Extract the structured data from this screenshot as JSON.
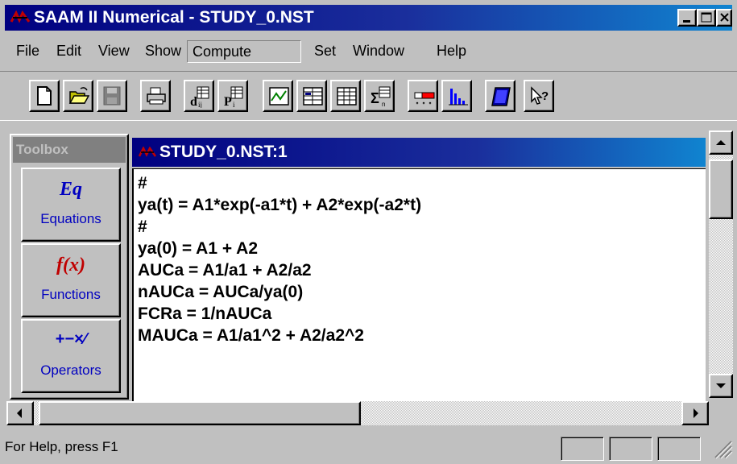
{
  "window": {
    "title": "SAAM II Numerical - STUDY_0.NST",
    "icon": "saam-app-icon"
  },
  "caption_buttons": [
    {
      "name": "minimize",
      "icon": "minimize-icon"
    },
    {
      "name": "maximize",
      "icon": "maximize-icon"
    },
    {
      "name": "close",
      "icon": "close-icon"
    }
  ],
  "menu": {
    "items": [
      {
        "label": "File"
      },
      {
        "label": "Edit"
      },
      {
        "label": "View"
      },
      {
        "label": "Show"
      },
      {
        "label": "Compute",
        "active": true
      },
      {
        "label": "Set"
      },
      {
        "label": "Window"
      },
      {
        "label": "Help"
      }
    ]
  },
  "toolbar": {
    "buttons": [
      {
        "name": "new",
        "icon": "new-document-icon"
      },
      {
        "name": "open",
        "icon": "open-folder-icon"
      },
      {
        "name": "save",
        "icon": "save-disk-icon"
      },
      {
        "name": "print",
        "icon": "printer-icon"
      },
      {
        "name": "data",
        "icon": "data-dij-icon"
      },
      {
        "name": "parameters",
        "icon": "parameters-pi-icon"
      },
      {
        "name": "plot",
        "icon": "plot-icon"
      },
      {
        "name": "table",
        "icon": "table-icon"
      },
      {
        "name": "table2",
        "icon": "table-grid-icon"
      },
      {
        "name": "statistics",
        "icon": "sigma-icon"
      },
      {
        "name": "settings",
        "icon": "slider-settings-icon"
      },
      {
        "name": "histogram",
        "icon": "bar-chart-icon"
      },
      {
        "name": "notebook",
        "icon": "notebook-icon"
      },
      {
        "name": "context-help",
        "icon": "context-help-icon"
      }
    ]
  },
  "toolbox": {
    "title": "Toolbox",
    "tools": [
      {
        "symbol": "Eq",
        "label": "Equations"
      },
      {
        "symbol": "f(x)",
        "label": "Functions"
      },
      {
        "symbol": "+−×⁄",
        "label": "Operators"
      }
    ]
  },
  "document": {
    "title": "STUDY_0.NST:1",
    "lines": [
      "#",
      "ya(t) = A1*exp(-a1*t) + A2*exp(-a2*t)",
      "#",
      "ya(0) = A1 + A2",
      "AUCa = A1/a1 + A2/a2",
      "nAUCa = AUCa/ya(0)",
      "FCRa = 1/nAUCa",
      "MAUCa = A1/a1^2 + A2/a2^2"
    ]
  },
  "statusbar": {
    "text": "For Help, press F1"
  },
  "colors": {
    "title_active": "#000080",
    "face": "#c0c0c0",
    "tool_label": "#0000c0"
  }
}
